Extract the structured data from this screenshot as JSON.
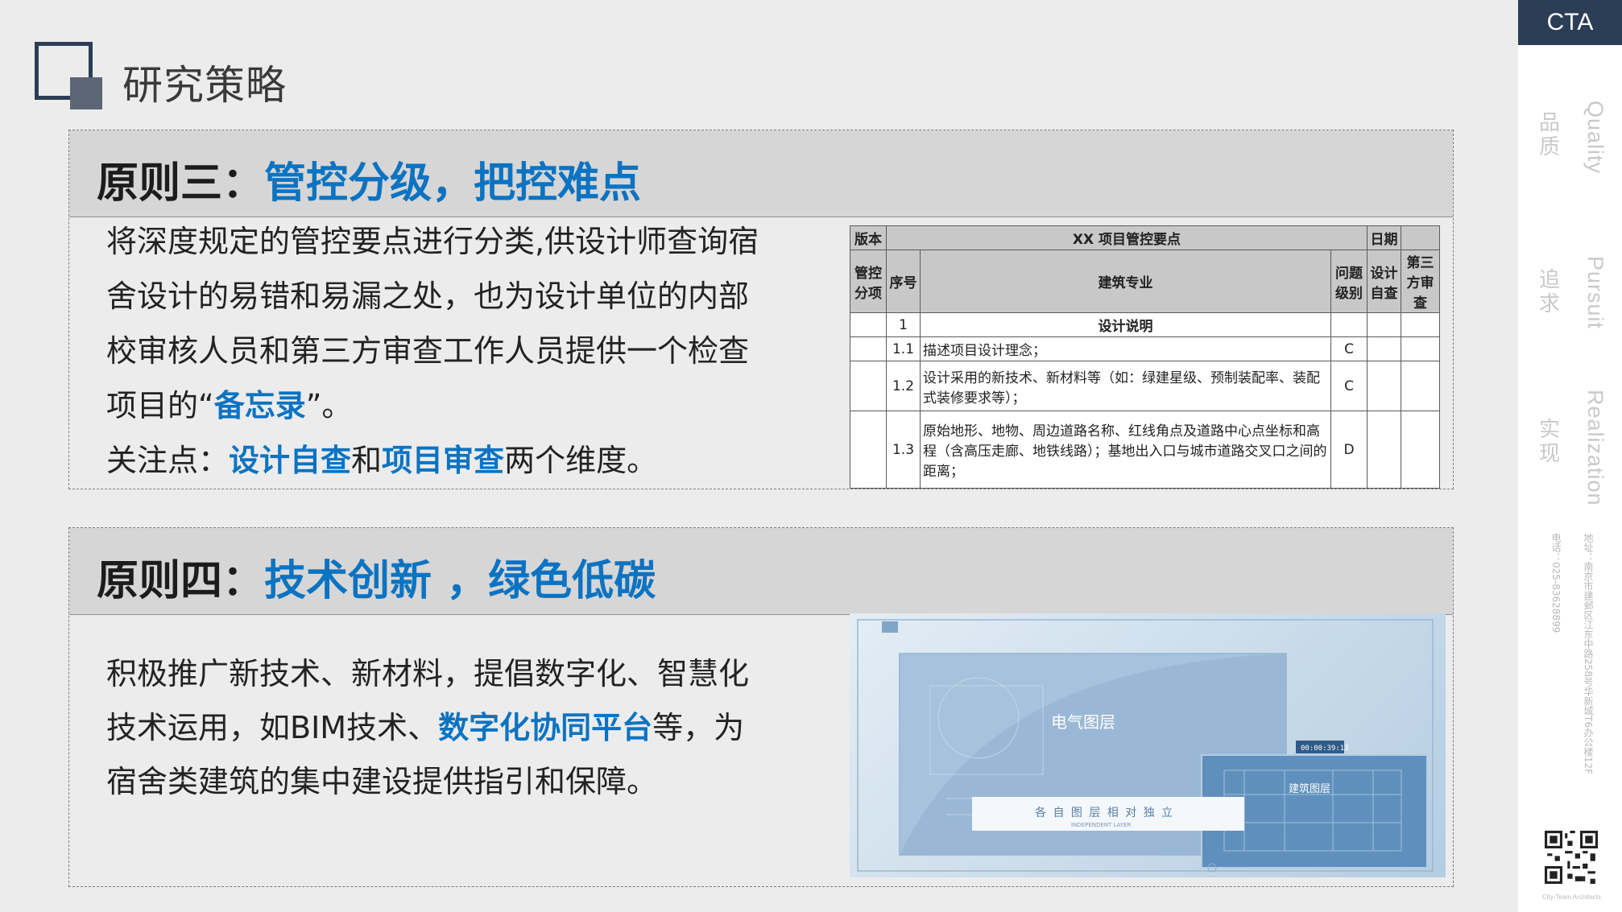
{
  "header": {
    "title": "研究策略"
  },
  "section3": {
    "title_prefix": "原则三：",
    "title_highlight": "管控分级，把控难点",
    "paragraph": {
      "line1": "将深度规定的管控要点进行分类,供设计师查询宿",
      "line2": "舍设计的易错和易漏之处，也为设计单位的内部",
      "line3": "校审核人员和第三方审查工作人员提供一个检查",
      "line4_a": "项目的“",
      "line4_hl": "备忘录",
      "line4_b": "”。",
      "line5_a": "关注点：",
      "line5_hl1": "设计自查",
      "line5_mid": "和",
      "line5_hl2": "项目审查",
      "line5_b": "两个维度。"
    },
    "table": {
      "version": "版本",
      "title": "XX 项目管控要点",
      "date": "日期",
      "col_category": "管控分项",
      "col_seq": "序号",
      "col_discipline": "建筑专业",
      "col_level": "问题级别",
      "col_self": "设计自查",
      "col_third": "第三方审查",
      "rows": [
        {
          "seq": "1",
          "text": "设计说明",
          "level": ""
        },
        {
          "seq": "1.1",
          "text": "描述项目设计理念；",
          "level": "C"
        },
        {
          "seq": "1.2",
          "text": "设计采用的新技术、新材料等（如：绿建星级、预制装配率、装配式装修要求等）；",
          "level": "C"
        },
        {
          "seq": "1.3",
          "text": "原始地形、地物、周边道路名称、红线角点及道路中心点坐标和高程（含高压走廊、地铁线路）；基地出入口与城市道路交叉口之间的距离；",
          "level": "D"
        }
      ]
    }
  },
  "section4": {
    "title_prefix": "原则四：",
    "title_highlight": "技术创新 ，绿色低碳",
    "paragraph": {
      "line1": "积极推广新技术、新材料，提倡数字化、智慧化",
      "line2_a": "技术运用，如BIM技术、",
      "line2_hl": "数字化协同平台",
      "line2_b": "等，为",
      "line3": "宿舍类建筑的集中建设提供指引和保障。"
    },
    "image": {
      "layer_label": "电气图层",
      "timer": "00:00:39:13",
      "sub_label": "建筑图层",
      "banner": "各 自 图 层 相 对 独 立",
      "banner_en": "INDEPENDENT LAYER"
    }
  },
  "sidebar": {
    "brand": "CTA",
    "items": [
      {
        "cn": "品质",
        "en": "Quality"
      },
      {
        "cn": "追求",
        "en": "Pursuit"
      },
      {
        "cn": "实现",
        "en": "Realization"
      }
    ],
    "phone": "电话：025-83628899",
    "address": "地址：南京市建邺区江东中路258号华新城T6办公楼12F",
    "qr_caption": "City-Team Architects"
  },
  "colors": {
    "accent": "#0b73c2",
    "brand": "#2b3e55"
  }
}
